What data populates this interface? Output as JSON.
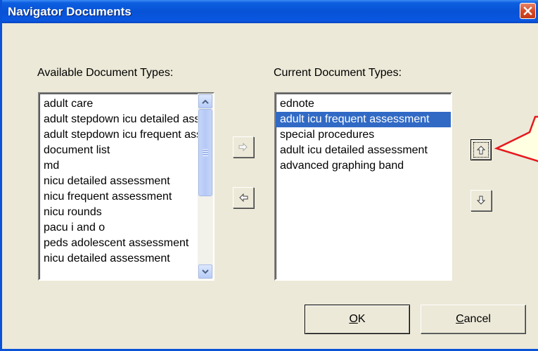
{
  "window": {
    "title": "Navigator Documents"
  },
  "available": {
    "label": "Available Document Types:",
    "items": [
      "adult care",
      "adult stepdown icu detailed assessment",
      "adult stepdown icu frequent assessment",
      "document list",
      "md",
      "nicu detailed assessment",
      "nicu frequent assessment",
      "nicu rounds",
      "pacu i and o",
      "peds adolescent assessment",
      "nicu detailed assessment"
    ]
  },
  "current": {
    "label": "Current Document Types:",
    "items": [
      "ednote",
      "adult icu frequent assessment",
      "special procedures",
      "adult icu detailed assessment",
      "advanced graphing band"
    ],
    "selected_index": 1
  },
  "buttons": {
    "ok_mnemonic": "O",
    "ok_rest": "K",
    "cancel_mnemonic": "C",
    "cancel_rest": "ancel"
  },
  "icons": {
    "add": "arrow-right-icon",
    "remove": "arrow-left-icon",
    "move_up": "arrow-up-icon",
    "move_down": "arrow-down-icon",
    "close": "close-x-icon"
  },
  "colors": {
    "titlebar": "#0752d6",
    "selection": "#316ac5",
    "callout_fill": "#ffffe1",
    "callout_border": "#e8171e"
  }
}
